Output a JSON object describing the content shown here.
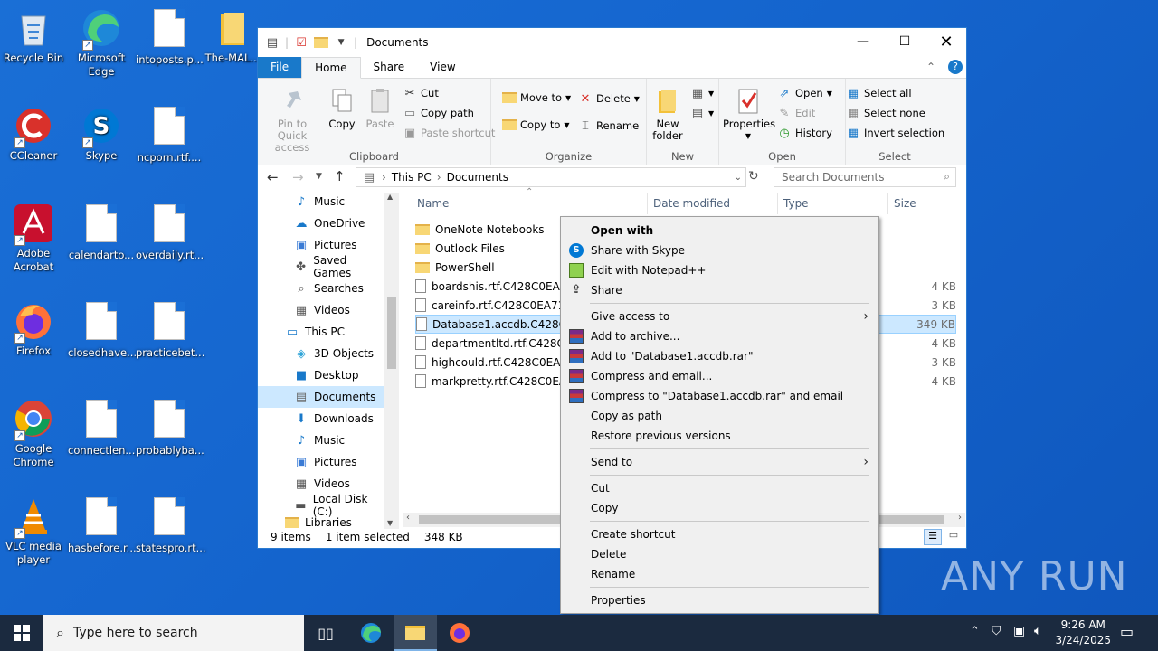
{
  "desktop": {
    "icons": [
      {
        "label": "Recycle Bin"
      },
      {
        "label": "Microsoft Edge"
      },
      {
        "label": "intoposts.p..."
      },
      {
        "label": "The-MAL..."
      },
      {
        "label": "CCleaner"
      },
      {
        "label": "Skype"
      },
      {
        "label": "ncporn.rtf...."
      },
      {
        "label": "Adobe Acrobat"
      },
      {
        "label": "calendarto..."
      },
      {
        "label": "overdaily.rt..."
      },
      {
        "label": "Firefox"
      },
      {
        "label": "closedhave..."
      },
      {
        "label": "practicebet..."
      },
      {
        "label": "Google Chrome"
      },
      {
        "label": "connectlen..."
      },
      {
        "label": "probablyba..."
      },
      {
        "label": "VLC media player"
      },
      {
        "label": "hasbefore.r..."
      },
      {
        "label": "statespro.rt..."
      }
    ]
  },
  "window": {
    "title": "Documents",
    "tabs": {
      "file": "File",
      "home": "Home",
      "share": "Share",
      "view": "View"
    },
    "clipboard": {
      "pin": "Pin to Quick access",
      "copy": "Copy",
      "paste": "Paste",
      "cut": "Cut",
      "copy_path": "Copy path",
      "paste_shortcut": "Paste shortcut",
      "label": "Clipboard"
    },
    "organize": {
      "move_to": "Move to",
      "copy_to": "Copy to",
      "delete": "Delete",
      "rename": "Rename",
      "label": "Organize"
    },
    "new": {
      "new_folder": "New folder",
      "label": "New"
    },
    "open": {
      "properties": "Properties",
      "open": "Open",
      "edit": "Edit",
      "history": "History",
      "label": "Open"
    },
    "select": {
      "select_all": "Select all",
      "select_none": "Select none",
      "invert": "Invert selection",
      "label": "Select"
    },
    "address": {
      "this_pc": "This PC",
      "documents": "Documents",
      "search_placeholder": "Search Documents"
    },
    "nav_items": [
      {
        "label": "Music"
      },
      {
        "label": "OneDrive"
      },
      {
        "label": "Pictures"
      },
      {
        "label": "Saved Games"
      },
      {
        "label": "Searches"
      },
      {
        "label": "Videos"
      },
      {
        "label": "This PC"
      },
      {
        "label": "3D Objects"
      },
      {
        "label": "Desktop"
      },
      {
        "label": "Documents"
      },
      {
        "label": "Downloads"
      },
      {
        "label": "Music"
      },
      {
        "label": "Pictures"
      },
      {
        "label": "Videos"
      },
      {
        "label": "Local Disk (C:)"
      },
      {
        "label": "Libraries"
      }
    ],
    "columns": {
      "name": "Name",
      "date": "Date modified",
      "type": "Type",
      "size": "Size"
    },
    "files": [
      {
        "name": "OneNote Notebooks",
        "size": ""
      },
      {
        "name": "Outlook Files",
        "size": ""
      },
      {
        "name": "PowerShell",
        "size": ""
      },
      {
        "name": "boardshis.rtf.C428C0EA71",
        "size": "4 KB"
      },
      {
        "name": "careinfo.rtf.C428C0EA7179",
        "size": "3 KB"
      },
      {
        "name": "Database1.accdb.C428C0E",
        "size": "349 KB"
      },
      {
        "name": "departmentltd.rtf.C428C0",
        "size": "4 KB"
      },
      {
        "name": "highcould.rtf.C428C0EA71",
        "size": "3 KB"
      },
      {
        "name": "markpretty.rtf.C428C0EA7",
        "size": "4 KB"
      }
    ],
    "status": {
      "count": "9 items",
      "selected": "1 item selected",
      "size": "348 KB"
    }
  },
  "context_menu": {
    "items": [
      "Open with",
      "Share with Skype",
      "Edit with Notepad++",
      "Share",
      "Give access to",
      "Add to archive...",
      "Add to \"Database1.accdb.rar\"",
      "Compress and email...",
      "Compress to \"Database1.accdb.rar\" and email",
      "Copy as path",
      "Restore previous versions",
      "Send to",
      "Cut",
      "Copy",
      "Create shortcut",
      "Delete",
      "Rename",
      "Properties"
    ]
  },
  "taskbar": {
    "search_placeholder": "Type here to search",
    "time": "9:26 AM",
    "date": "3/24/2025"
  },
  "watermark": "ANY RUN"
}
